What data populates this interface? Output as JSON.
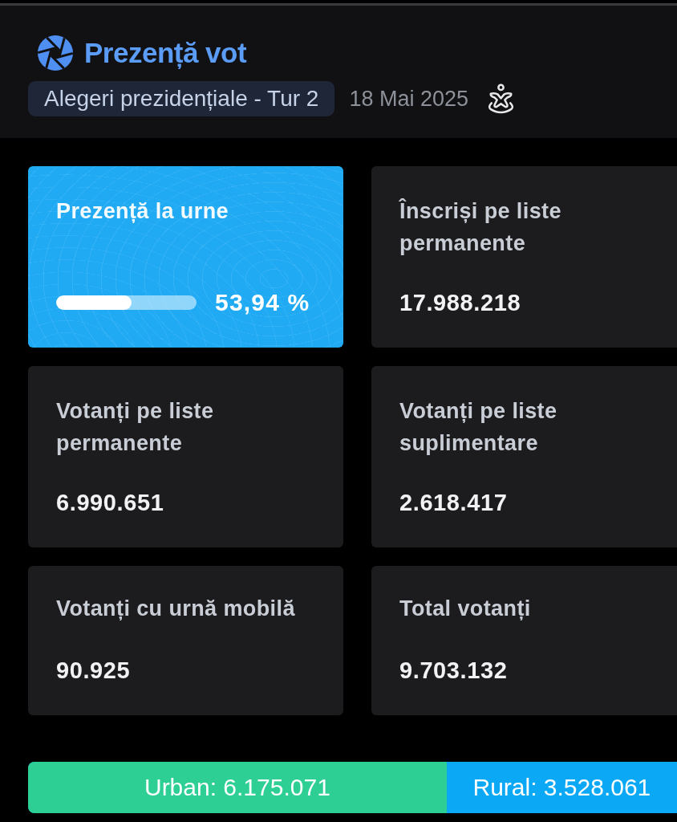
{
  "header": {
    "title": "Prezență vot",
    "badge": "Alegeri prezidențiale - Tur 2",
    "date": "18 Mai 2025"
  },
  "cards": [
    {
      "kind": "progress",
      "label": "Prezență la urne",
      "level": 0.5394,
      "value": "53,94 %"
    },
    {
      "kind": "stat",
      "label": "Înscriși pe liste permanente",
      "value": "17.988.218"
    },
    {
      "kind": "stat",
      "label": "Votanți pe liste permanente",
      "value": "6.990.651"
    },
    {
      "kind": "stat",
      "label": "Votanți pe liste suplimentare",
      "value": "2.618.417"
    },
    {
      "kind": "stat",
      "label": "Votanți cu urnă mobilă",
      "value": "90.925"
    },
    {
      "kind": "stat",
      "label": "Total votanți",
      "value": "9.703.132"
    }
  ],
  "split_bar": {
    "level": 0.645,
    "segments": [
      {
        "label": "Urban: 6.175.071",
        "color": "#2ecf94"
      },
      {
        "label": "Rural: 3.528.061",
        "color": "#0aa8f5"
      }
    ]
  }
}
